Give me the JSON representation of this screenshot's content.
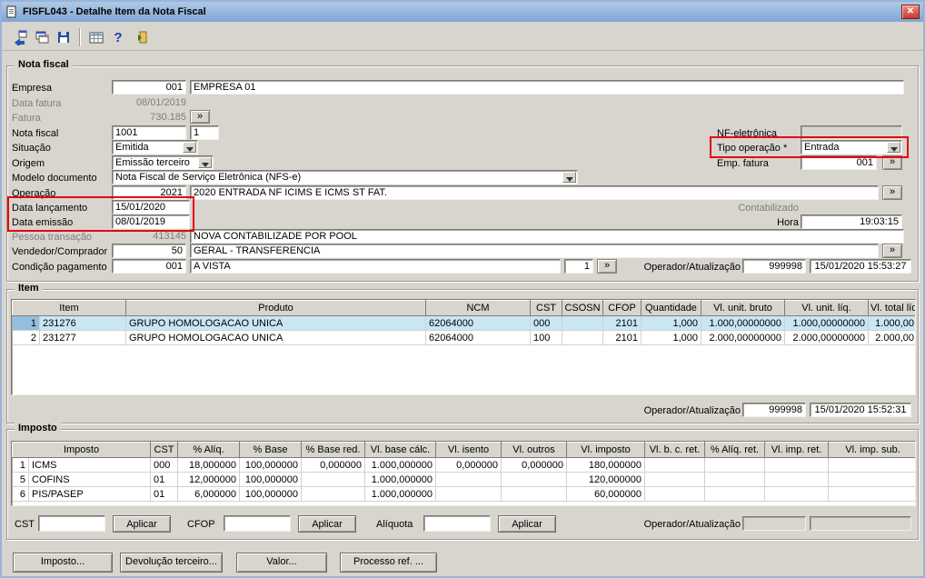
{
  "glyphs": {
    "lookup": "»",
    "close": "✕"
  },
  "window": {
    "title": "FISFL043 - Detalhe Item da Nota Fiscal"
  },
  "toolbar": {
    "icons": [
      "transfer-icon",
      "copy-window-icon",
      "save-icon",
      "grid-icon",
      "help-icon",
      "exit-icon"
    ]
  },
  "nota_fiscal": {
    "legend": "Nota fiscal",
    "empresa_label": "Empresa",
    "empresa_code": "001",
    "empresa_name": "EMPRESA 01",
    "data_fatura_label": "Data fatura",
    "data_fatura": "08/01/2019",
    "fatura_label": "Fatura",
    "fatura": "730.185",
    "nota_fiscal_label": "Nota fiscal",
    "nota_fiscal_numero": "1001",
    "nota_fiscal_serie": "1",
    "situacao_label": "Situação",
    "situacao": "Emitida",
    "origem_label": "Origem",
    "origem": "Emissão terceiro",
    "modelo_documento_label": "Modelo documento",
    "modelo_documento": "Nota Fiscal de Serviço Eletrônica (NFS-e)",
    "operacao_label": "Operação",
    "operacao_code": "2021",
    "operacao_desc": "2020 ENTRADA NF ICIMS E ICMS ST FAT.",
    "data_lancamento_label": "Data lançamento",
    "data_lancamento": "15/01/2020",
    "data_emissao_label": "Data emissão",
    "data_emissao": "08/01/2019",
    "nf_eletronica_label": "NF-eletrônica",
    "nf_eletronica": "",
    "tipo_operacao_label": "Tipo operação *",
    "tipo_operacao": "Entrada",
    "emp_fatura_label": "Emp. fatura",
    "emp_fatura": "001",
    "contabilizado_label": "Contabilizado",
    "hora_label": "Hora",
    "hora": "19:03:15",
    "pessoa_transacao_label": "Pessoa transação",
    "pessoa_transacao_code": "413145",
    "pessoa_transacao_desc": "NOVA CONTABILIZADE POR POOL",
    "vendedor_label": "Vendedor/Comprador",
    "vendedor_code": "50",
    "vendedor_desc": "GERAL - TRANSFERENCIA",
    "condicao_label": "Condição pagamento",
    "condicao_code": "001",
    "condicao_desc": "A VISTA",
    "parcelas": "1",
    "operador_label": "Operador/Atualização",
    "operador_code": "999998",
    "operador_datetime": "15/01/2020 15:53:27"
  },
  "item": {
    "legend": "Item",
    "columns": [
      "Item",
      "Produto",
      "NCM",
      "CST",
      "CSOSN",
      "CFOP",
      "Quantidade",
      "Vl. unit. bruto",
      "Vl. unit. líq.",
      "Vl. total líq."
    ],
    "rows": [
      {
        "selected": true,
        "cells": [
          "1",
          "231276",
          "GRUPO HOMOLOGACAO UNICA",
          "62064000",
          "000",
          "",
          "2101",
          "1,000",
          "1.000,00000000",
          "1.000,00000000",
          "1.000,00"
        ]
      },
      {
        "selected": false,
        "cells": [
          "2",
          "231277",
          "GRUPO HOMOLOGACAO UNICA",
          "62064000",
          "100",
          "",
          "2101",
          "1,000",
          "2.000,00000000",
          "2.000,00000000",
          "2.000,00"
        ]
      }
    ],
    "operador_label": "Operador/Atualização",
    "operador_code": "999998",
    "operador_datetime": "15/01/2020 15:52:31"
  },
  "imposto": {
    "legend": "Imposto",
    "columns": [
      "Imposto",
      "CST",
      "% Alíq.",
      "% Base",
      "% Base red.",
      "Vl. base cálc.",
      "Vl. isento",
      "Vl. outros",
      "Vl. imposto",
      "Vl. b. c. ret.",
      "% Alíq. ret.",
      "Vl. imp. ret.",
      "Vl. imp. sub."
    ],
    "rows": [
      {
        "selected": false,
        "cells": [
          "1",
          "ICMS",
          "000",
          "18,000000",
          "100,000000",
          "0,000000",
          "1.000,000000",
          "0,000000",
          "0,000000",
          "180,000000",
          "",
          "",
          "",
          ""
        ]
      },
      {
        "selected": false,
        "cells": [
          "5",
          "COFINS",
          "01",
          "12,000000",
          "100,000000",
          "",
          "1.000,000000",
          "",
          "",
          "120,000000",
          "",
          "",
          "",
          ""
        ]
      },
      {
        "selected": false,
        "cells": [
          "6",
          "PIS/PASEP",
          "01",
          "6,000000",
          "100,000000",
          "",
          "1.000,000000",
          "",
          "",
          "60,000000",
          "",
          "",
          "",
          ""
        ]
      }
    ],
    "cst_label": "CST",
    "cst_value": "",
    "cfop_label": "CFOP",
    "cfop_value": "",
    "aliquota_label": "Alíquota",
    "aliquota_value": "",
    "aplicar_label": "Aplicar",
    "operador_label": "Operador/Atualização"
  },
  "footer_buttons": [
    "Imposto...",
    "Devolução terceiro...",
    "Valor...",
    "Processo ref. ..."
  ]
}
